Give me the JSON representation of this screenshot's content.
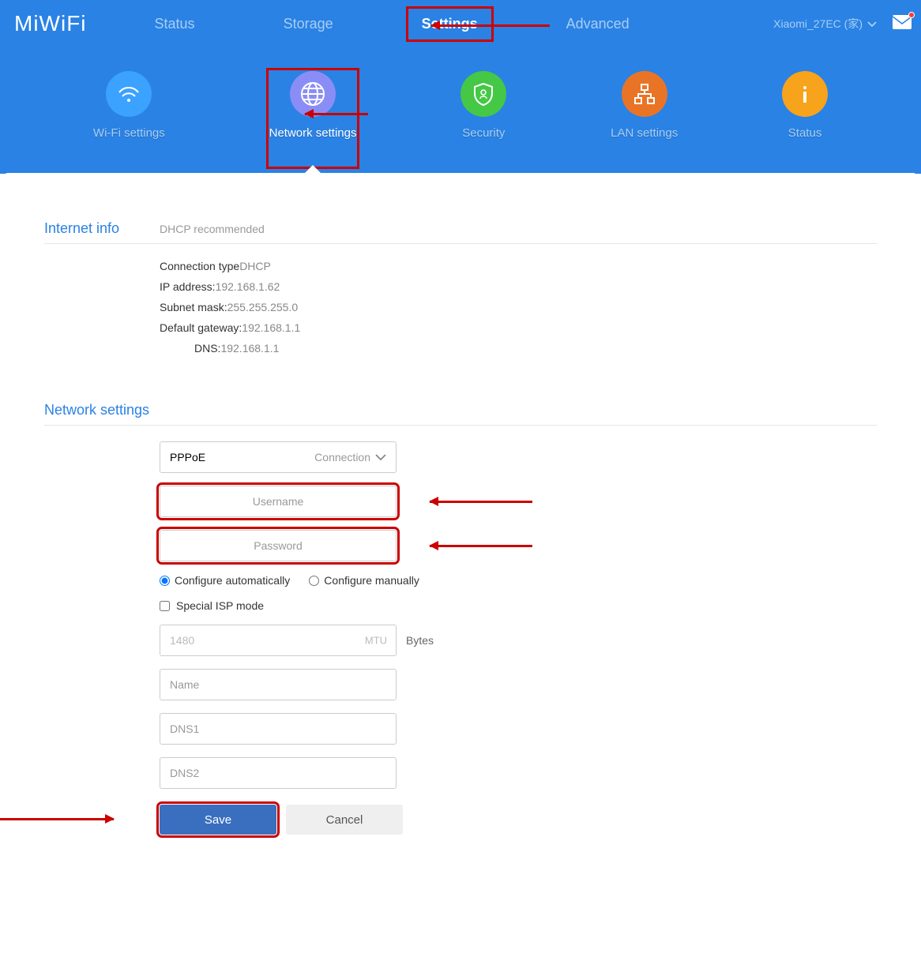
{
  "brand": "MiWiFi",
  "nav": {
    "status": "Status",
    "storage": "Storage",
    "settings": "Settings",
    "advanced": "Advanced"
  },
  "device": {
    "name": "Xiaomi_27EC (家)"
  },
  "submenu": {
    "wifi": "Wi-Fi settings",
    "network": "Network settings",
    "security": "Security",
    "lan": "LAN settings",
    "status": "Status"
  },
  "internet_info": {
    "title": "Internet info",
    "subtitle": "DHCP recommended",
    "conn_type_label": "Connection type",
    "conn_type_value": "DHCP",
    "ip_label": "IP address:",
    "ip_value": "192.168.1.62",
    "mask_label": "Subnet mask:",
    "mask_value": "255.255.255.0",
    "gw_label": "Default gateway:",
    "gw_value": "192.168.1.1",
    "dns_label": "DNS:",
    "dns_value": "192.168.1.1"
  },
  "network_settings": {
    "title": "Network settings",
    "connection_value": "PPPoE",
    "connection_hint": "Connection",
    "username_ph": "Username",
    "password_ph": "Password",
    "auto_label": "Configure automatically",
    "manual_label": "Configure manually",
    "special_isp_label": "Special ISP mode",
    "mtu_value": "1480",
    "mtu_hint": "MTU",
    "bytes_label": "Bytes",
    "name_ph": "Name",
    "dns1_ph": "DNS1",
    "dns2_ph": "DNS2",
    "save_label": "Save",
    "cancel_label": "Cancel"
  }
}
